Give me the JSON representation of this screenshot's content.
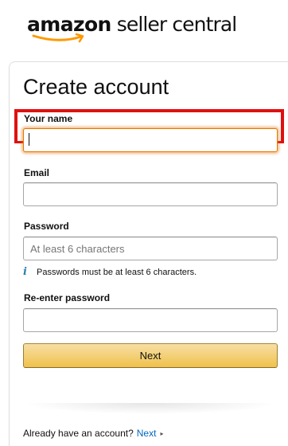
{
  "brand": {
    "logo_amazon": "amazon",
    "logo_rest": "seller central"
  },
  "form": {
    "title": "Create account",
    "name": {
      "label": "Your name",
      "value": "",
      "placeholder": ""
    },
    "email": {
      "label": "Email",
      "value": "",
      "placeholder": ""
    },
    "password": {
      "label": "Password",
      "value": "",
      "placeholder": "At least 6 characters"
    },
    "password_hint": "Passwords must be at least 6 characters.",
    "reenter": {
      "label": "Re-enter password",
      "value": "",
      "placeholder": ""
    },
    "next_label": "Next"
  },
  "footer": {
    "signin_text": "Already have an account?",
    "signin_link": "Next"
  },
  "icons": {
    "hint": "info-icon",
    "link_caret": "caret-right-icon"
  },
  "colors": {
    "highlight": "#e01010",
    "button": "#f0c14b",
    "link": "#0066c0",
    "focus": "#e77600"
  }
}
